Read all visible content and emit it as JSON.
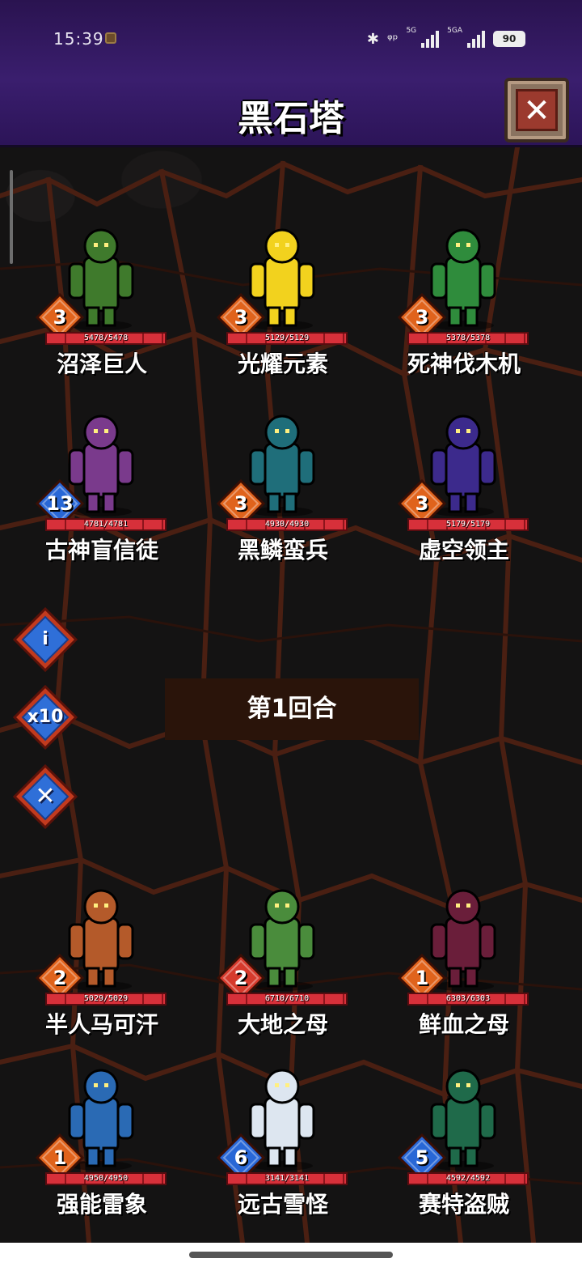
{
  "status_bar": {
    "time": "15:39",
    "signal1_label": "5G",
    "signal2_label": "5GA",
    "battery": "90"
  },
  "header": {
    "title": "黑石塔",
    "close_icon": "close-icon"
  },
  "round_text": "第1回合",
  "side_buttons": [
    {
      "icon": "info-icon",
      "label": "i"
    },
    {
      "icon": "speed-x10-icon",
      "label": "x10"
    },
    {
      "icon": "cancel-icon",
      "label": "✕"
    }
  ],
  "enemies": [
    {
      "name": "沼泽巨人",
      "level": "3",
      "hp": "5478/5478",
      "badge_color": "#e0631c",
      "sprite_color": "#3f7a2c",
      "sprite": "swamp-giant-icon"
    },
    {
      "name": "光耀元素",
      "level": "3",
      "hp": "5129/5129",
      "badge_color": "#e0631c",
      "sprite_color": "#f2d21e",
      "sprite": "light-elemental-icon"
    },
    {
      "name": "死神伐木机",
      "level": "3",
      "hp": "5378/5378",
      "badge_color": "#e0631c",
      "sprite_color": "#2f8c3c",
      "sprite": "reaper-logger-icon"
    },
    {
      "name": "古神盲信徒",
      "level": "13",
      "hp": "4781/4781",
      "badge_color": "#2867d6",
      "sprite_color": "#7a3a8c",
      "sprite": "old-god-zealot-icon"
    },
    {
      "name": "黑鳞蛮兵",
      "level": "3",
      "hp": "4930/4930",
      "badge_color": "#e0631c",
      "sprite_color": "#1f6e7a",
      "sprite": "blackscale-brute-icon"
    },
    {
      "name": "虚空领主",
      "level": "3",
      "hp": "5179/5179",
      "badge_color": "#e0631c",
      "sprite_color": "#3c2a8c",
      "sprite": "void-lord-icon"
    }
  ],
  "allies": [
    {
      "name": "半人马可汗",
      "level": "2",
      "hp": "5029/5029",
      "badge_color": "#e0631c",
      "sprite_color": "#b45a2a",
      "sprite": "centaur-khan-icon"
    },
    {
      "name": "大地之母",
      "level": "2",
      "hp": "6710/6710",
      "badge_color": "#d63a2c",
      "sprite_color": "#4a8c3c",
      "sprite": "earth-mother-icon"
    },
    {
      "name": "鲜血之母",
      "level": "1",
      "hp": "6303/6303",
      "badge_color": "#e0631c",
      "sprite_color": "#6a1e3a",
      "sprite": "blood-mother-spider-icon"
    },
    {
      "name": "强能雷象",
      "level": "1",
      "hp": "4950/4950",
      "badge_color": "#e0631c",
      "sprite_color": "#2a6ab4",
      "sprite": "thunder-elephant-icon"
    },
    {
      "name": "远古雪怪",
      "level": "6",
      "hp": "3141/3141",
      "badge_color": "#2867d6",
      "sprite_color": "#dde6f0",
      "sprite": "ancient-yeti-icon"
    },
    {
      "name": "赛特盗贼",
      "level": "5",
      "hp": "4592/4592",
      "badge_color": "#2867d6",
      "sprite_color": "#1f6a4a",
      "sprite": "sethrak-rogue-icon"
    }
  ]
}
